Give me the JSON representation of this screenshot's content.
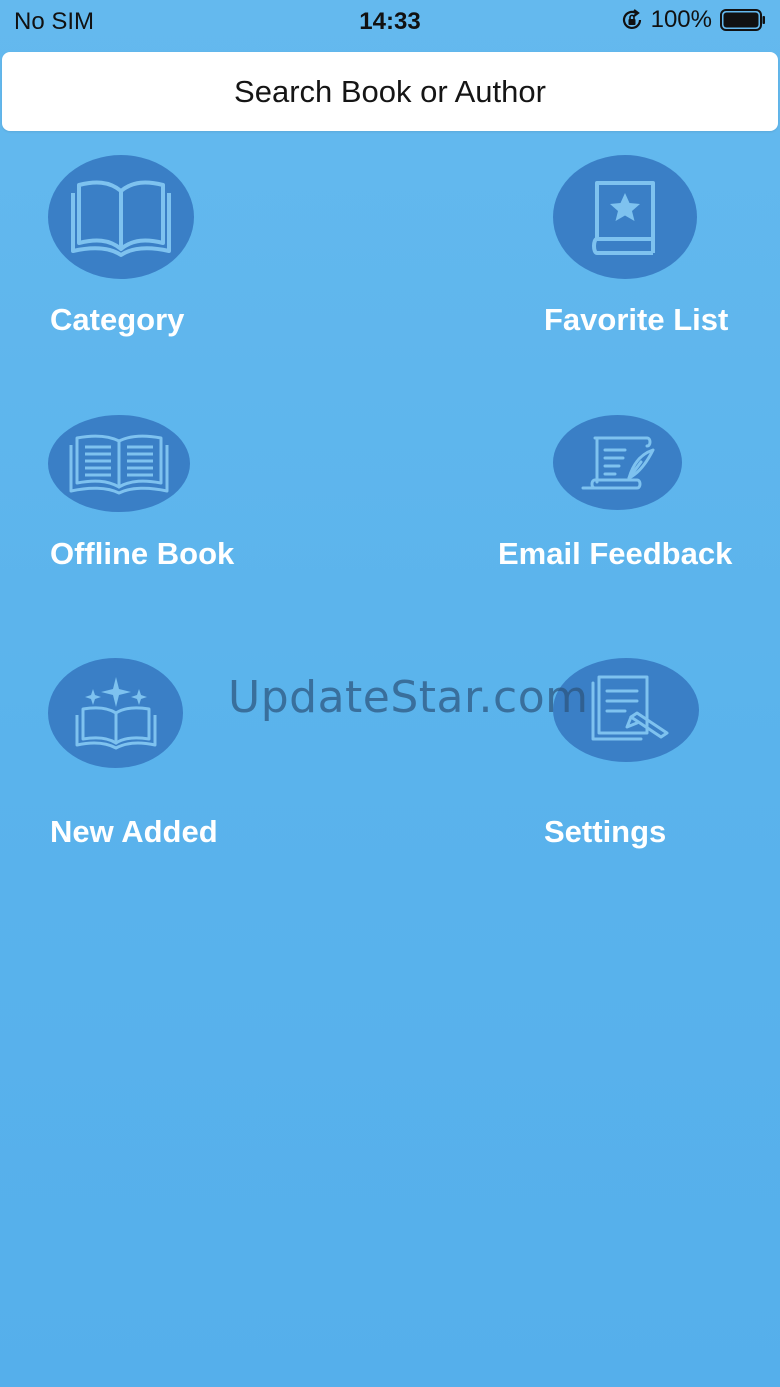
{
  "status_bar": {
    "carrier": "No SIM",
    "time": "14:33",
    "battery": "100%"
  },
  "search": {
    "placeholder": "Search Book or Author"
  },
  "menu": {
    "category": "Category",
    "favorite_list": "Favorite List",
    "offline_book": "Offline Book",
    "email_feedback": "Email Feedback",
    "new_added": "New Added",
    "settings": "Settings"
  },
  "watermark": "UpdateStar.com",
  "colors": {
    "background": "#5ab3ec",
    "icon_circle": "#3a7fc6",
    "icon_line": "#7ec2ef",
    "label": "#ffffff"
  }
}
